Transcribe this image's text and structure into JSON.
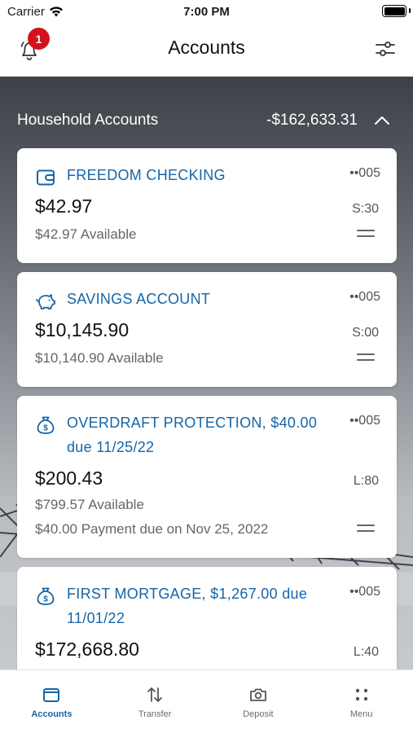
{
  "status_bar": {
    "carrier": "Carrier",
    "time": "7:00 PM"
  },
  "nav": {
    "title": "Accounts",
    "notification_count": "1"
  },
  "group": {
    "title": "Household Accounts",
    "total": "-$162,633.31"
  },
  "accounts": [
    {
      "name": "FREEDOM CHECKING",
      "mask": "••005",
      "balance": "$42.97",
      "code": "S:30",
      "available": "$42.97 Available",
      "icon": "wallet-icon"
    },
    {
      "name": "SAVINGS ACCOUNT",
      "mask": "••005",
      "balance": "$10,145.90",
      "code": "S:00",
      "available": "$10,140.90 Available",
      "icon": "piggy-bank-icon"
    },
    {
      "name": "OVERDRAFT PROTECTION, $40.00 due 11/25/22",
      "mask": "••005",
      "balance": "$200.43",
      "code": "L:80",
      "available": "$799.57 Available",
      "payment": "$40.00 Payment due on Nov 25, 2022",
      "icon": "money-bag-icon"
    },
    {
      "name": "FIRST MORTGAGE, $1,267.00 due 11/01/22",
      "mask": "••005",
      "balance": "$172,668.80",
      "code": "L:40",
      "icon": "money-bag-icon"
    }
  ],
  "tabs": [
    {
      "label": "Accounts",
      "icon": "wallet-icon",
      "active": true
    },
    {
      "label": "Transfer",
      "icon": "transfer-arrows-icon",
      "active": false
    },
    {
      "label": "Deposit",
      "icon": "camera-icon",
      "active": false
    },
    {
      "label": "Menu",
      "icon": "grid-dots-icon",
      "active": false
    }
  ],
  "colors": {
    "accent": "#1565a8",
    "badge": "#d6111e"
  }
}
